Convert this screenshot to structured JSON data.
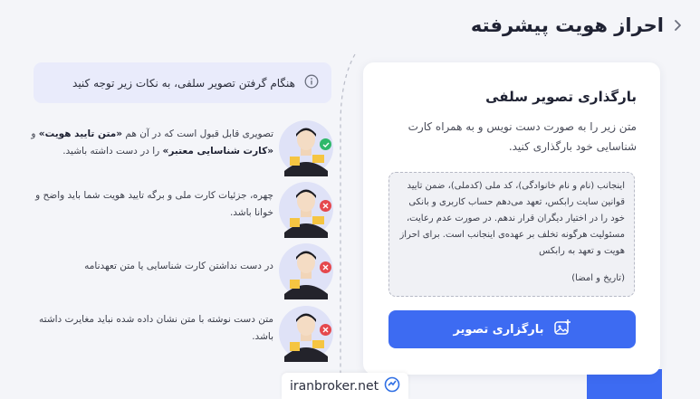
{
  "header": {
    "title": "احراز هویت پیشرفته"
  },
  "tip": {
    "text": "هنگام گرفتن تصویر سلفی، به نکات زیر توجه کنید"
  },
  "guidelines": [
    {
      "status": "valid",
      "lead": "تصویری قابل قبول است که در آن هم ",
      "bold1": "«متن تایید هویت»",
      "mid": " و ",
      "bold2": "«کارت شناسایی معتبر»",
      "tail": " را در دست داشته باشید."
    },
    {
      "status": "invalid",
      "text": "چهره، جزئیات کارت ملی و برگه تایید هویت شما باید واضح و خوانا باشد."
    },
    {
      "status": "invalid",
      "text": "در دست نداشتن کارت شناسایی یا متن تعهدنامه"
    },
    {
      "status": "invalid",
      "text": "متن دست نوشته با متن نشان داده شده نباید مغایرت داشته باشد."
    }
  ],
  "card": {
    "title": "بارگذاری تصویر سلفی",
    "description": "متن زیر را به صورت دست نویس و به همراه کارت شناسایی خود بارگذاری کنید.",
    "statement": "اینجانب (نام و نام خانوادگی)، کد ملی (کدملی)، ضمن تایید قوانین سایت رابکس، تعهد می‌دهم حساب کاربری و بانکی خود را در اختیار دیگران قرار ندهم. در صورت عدم رعایت، مسئولیت هرگونه تخلف بر عهده‌ی اینجانب است. برای احراز هویت و تعهد به رابکس",
    "signature": "(تاریخ و امضا)",
    "upload_label": "بارگزاری تصویر"
  },
  "watermark": {
    "text": "iranbroker.net"
  },
  "colors": {
    "accent": "#3d6bf2",
    "valid": "#2fb86a",
    "invalid": "#e5484d",
    "banner": "#e9ebfb"
  }
}
